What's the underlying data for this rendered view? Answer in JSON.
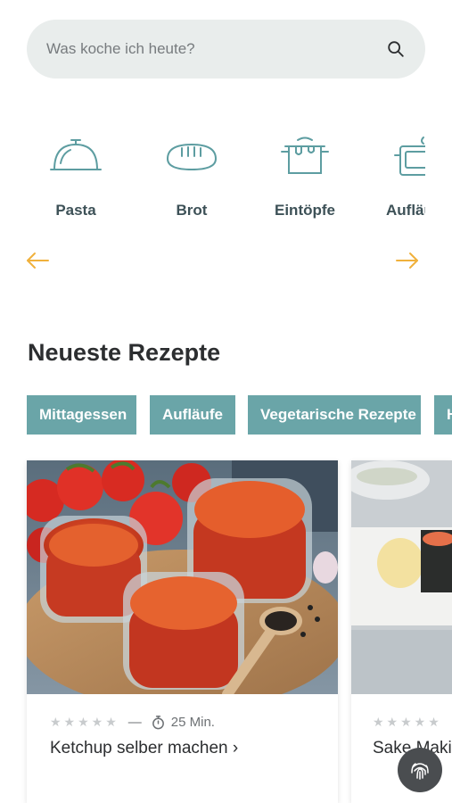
{
  "search": {
    "placeholder": "Was koche ich heute?"
  },
  "categories": [
    {
      "label": "Pasta",
      "icon": "cloche-icon"
    },
    {
      "label": "Brot",
      "icon": "bread-icon"
    },
    {
      "label": "Eintöpfe",
      "icon": "pot-icon"
    },
    {
      "label": "Aufläufe",
      "icon": "casserole-icon"
    }
  ],
  "carousel": {
    "prev_icon": "arrow-left-icon",
    "next_icon": "arrow-right-icon",
    "accent": "#f0b13c"
  },
  "section": {
    "title": "Neueste Rezepte"
  },
  "tags": [
    "Mittagessen",
    "Aufläufe",
    "Vegetarische Rezepte",
    "H"
  ],
  "recipes": [
    {
      "rating": 0,
      "stars": "★★★★★",
      "dash": "—",
      "time": "25 Min.",
      "title": "Ketchup selber machen ›"
    },
    {
      "rating": 0,
      "stars": "★★★★★",
      "title": "Sake Maki"
    }
  ],
  "colors": {
    "primary": "#6aa5a8",
    "icon_teal": "#5d9da1",
    "text_dark": "#2c2e30",
    "search_bg": "#e9edec"
  },
  "fab": {
    "icon": "fingerprint-icon"
  }
}
